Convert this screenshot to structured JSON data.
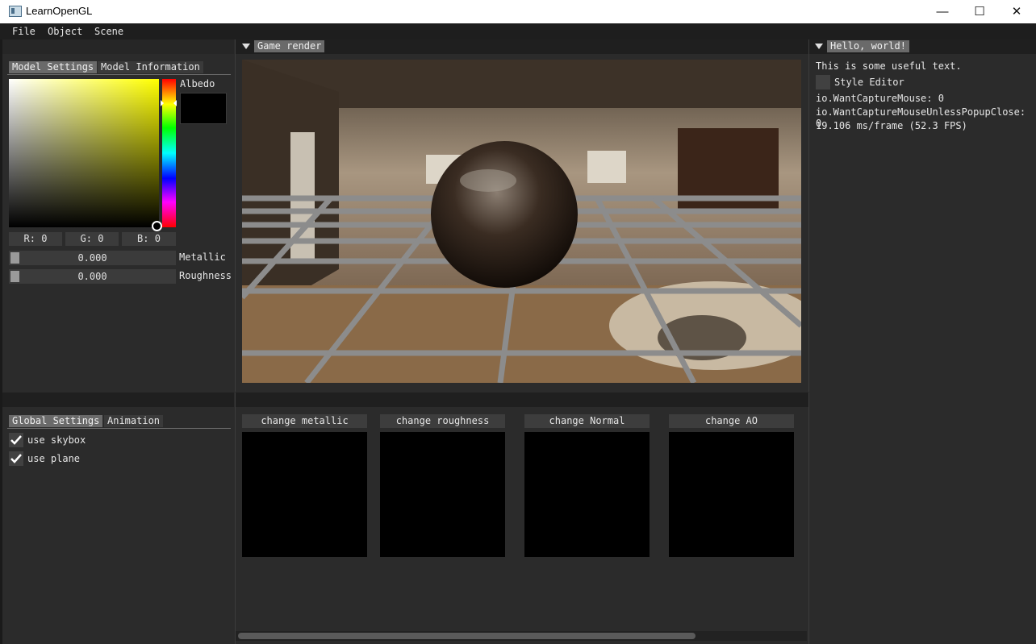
{
  "window": {
    "title": "LearnOpenGL",
    "minimize": "—",
    "maximize": "☐",
    "close": "✕"
  },
  "menu": [
    "File",
    "Object",
    "Scene"
  ],
  "model_panel": {
    "tabs": [
      "Model Settings",
      "Model Information"
    ],
    "active_tab": "Model Settings",
    "albedo_label": "Albedo",
    "r": "R:  0",
    "g": "G:  0",
    "b": "B:  0",
    "metallic_value": "0.000",
    "metallic_label": "Metallic",
    "roughness_value": "0.000",
    "roughness_label": "Roughness",
    "albedo_color": "#000000",
    "metallic_fraction": 0.0,
    "roughness_fraction": 0.0
  },
  "render_panel": {
    "tab": "Game render"
  },
  "hello_panel": {
    "tab": "Hello, world!",
    "text": "This is some useful text.",
    "style_editor": "Style Editor",
    "mouse_line": "io.WantCaptureMouse: 0",
    "popup_line": "io.WantCaptureMouseUnlessPopupClose: 0",
    "fps_line": "19.106 ms/frame (52.3 FPS)"
  },
  "global_panel": {
    "tabs": [
      "Global Settings",
      "Animation"
    ],
    "active_tab": "Global Settings",
    "checkboxes": [
      {
        "label": "use skybox",
        "checked": true
      },
      {
        "label": "use plane",
        "checked": true
      }
    ]
  },
  "texture_panel": {
    "buttons": [
      "change metallic",
      "change roughness",
      "change Normal",
      "change AO"
    ]
  },
  "colors": {
    "accent_active_tab": "#6a6a6a",
    "background": "#2b2b2b"
  }
}
